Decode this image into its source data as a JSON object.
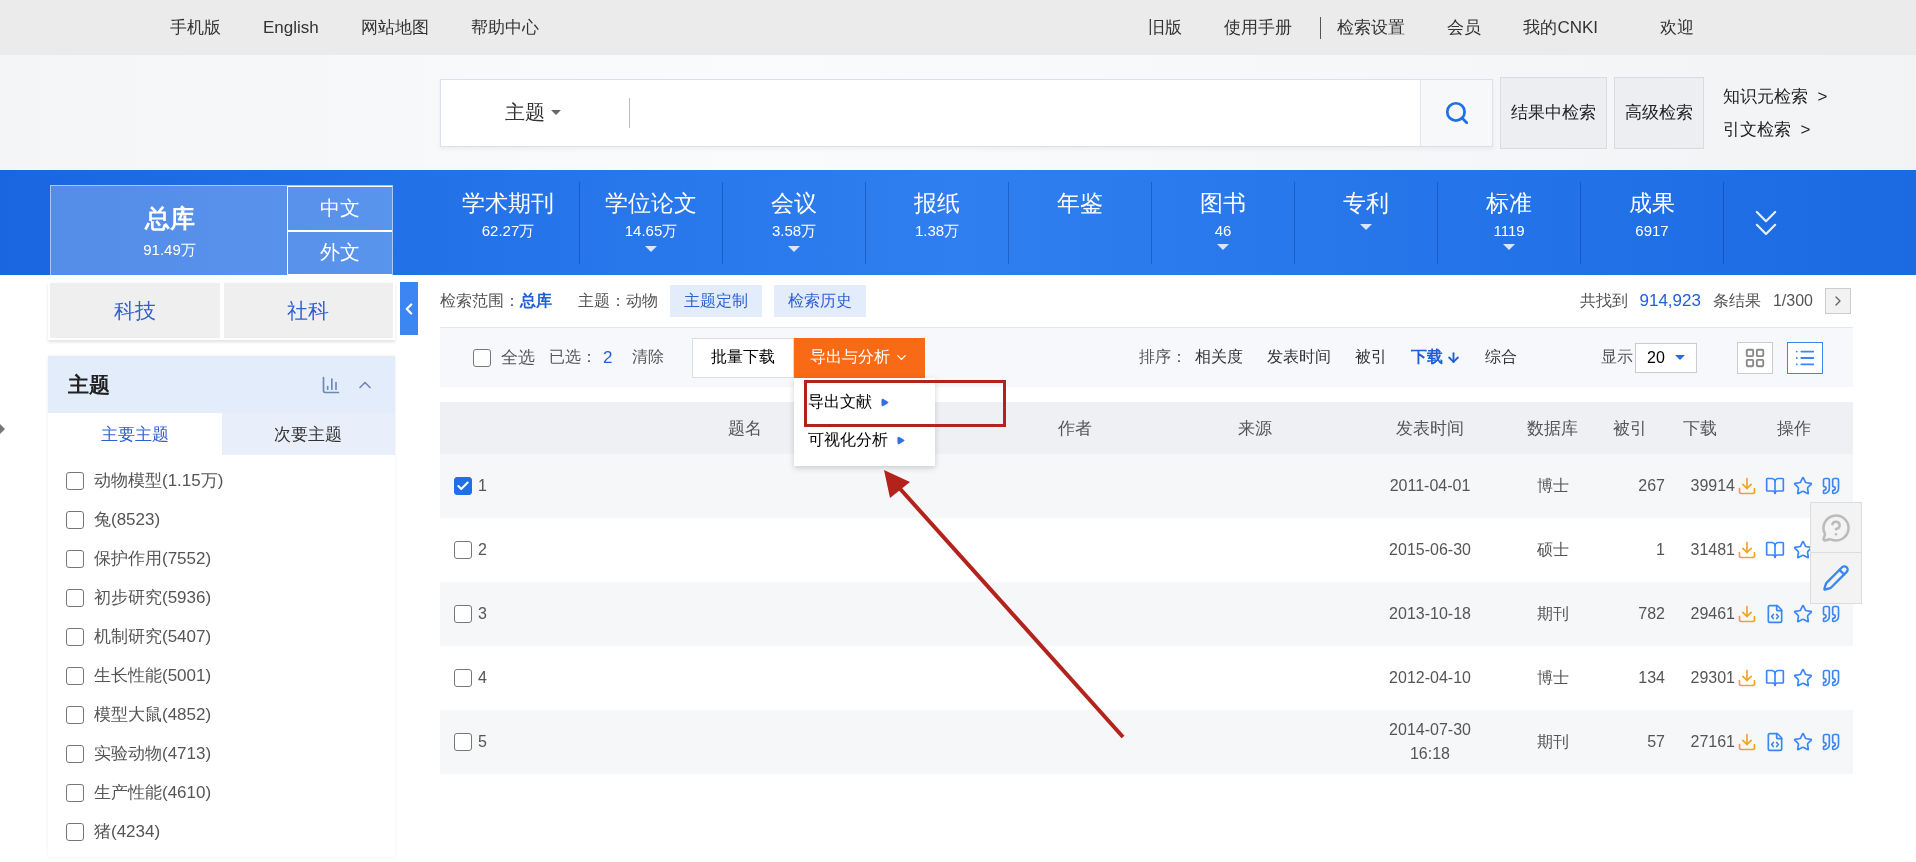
{
  "top_bar": {
    "left_links": [
      "手机版",
      "English",
      "网站地图",
      "帮助中心"
    ],
    "right_links": [
      "旧版",
      "使用手册",
      "检索设置",
      "会员",
      "我的CNKI",
      "欢迎"
    ]
  },
  "search": {
    "field_selector": "主题",
    "advanced_buttons": [
      "结果中检索",
      "高级检索"
    ],
    "side_links": [
      "知识元检索  >",
      "引文检索  >"
    ]
  },
  "database_nav": {
    "main": {
      "label": "总库",
      "count": "91.49万",
      "selected": true
    },
    "language_tabs": [
      {
        "label": "中文",
        "selected": false
      },
      {
        "label": "外文",
        "selected": false
      }
    ],
    "items": [
      {
        "label": "学术期刊",
        "count": "62.27万",
        "expandable": false
      },
      {
        "label": "学位论文",
        "count": "14.65万",
        "expandable": true
      },
      {
        "label": "会议",
        "count": "3.58万",
        "expandable": true
      },
      {
        "label": "报纸",
        "count": "1.38万",
        "expandable": false
      },
      {
        "label": "年鉴",
        "expandable": false
      },
      {
        "label": "图书",
        "count": "46",
        "expandable": true
      },
      {
        "label": "专利",
        "expandable": true
      },
      {
        "label": "标准",
        "count": "1119",
        "expandable": true
      },
      {
        "label": "成果",
        "count": "6917",
        "expandable": false
      }
    ]
  },
  "sidebar": {
    "categories": [
      "科技",
      "社科"
    ],
    "facet": {
      "title": "主题",
      "tabs": [
        {
          "label": "主要主题",
          "selected": true
        },
        {
          "label": "次要主题",
          "selected": false
        }
      ],
      "items": [
        {
          "label": "动物模型(1.15万)",
          "checked": false
        },
        {
          "label": "兔(8523)",
          "checked": false
        },
        {
          "label": "保护作用(7552)",
          "checked": false
        },
        {
          "label": "初步研究(5936)",
          "checked": false
        },
        {
          "label": "机制研究(5407)",
          "checked": false
        },
        {
          "label": "生长性能(5001)",
          "checked": false
        },
        {
          "label": "模型大鼠(4852)",
          "checked": false
        },
        {
          "label": "实验动物(4713)",
          "checked": false
        },
        {
          "label": "生产性能(4610)",
          "checked": false
        },
        {
          "label": "猪(4234)",
          "checked": false
        }
      ]
    }
  },
  "scope": {
    "label": "检索范围：",
    "value": "总库",
    "query": "主题：动物",
    "buttons": [
      "主题定制",
      "检索历史"
    ],
    "found_prefix": "共找到",
    "found_count": "914,923",
    "found_suffix": "条结果",
    "page": "1/300"
  },
  "toolbar": {
    "select_all": {
      "label": "全选",
      "checked": false
    },
    "selected_label": "已选：",
    "selected_count": "2",
    "clear": "清除",
    "batch_download": "批量下载",
    "export_menu": "导出与分析",
    "menu_items": [
      "导出文献",
      "可视化分析"
    ],
    "sort_label": "排序：",
    "sort_options": [
      {
        "label": "相关度",
        "selected": false
      },
      {
        "label": "发表时间",
        "selected": false
      },
      {
        "label": "被引",
        "selected": false
      },
      {
        "label": "下载",
        "selected": true
      },
      {
        "label": "综合",
        "selected": false
      }
    ],
    "display_label": "显示",
    "page_size": "20"
  },
  "table": {
    "columns": [
      "题名",
      "作者",
      "来源",
      "发表时间",
      "数据库",
      "被引",
      "下载",
      "操作"
    ],
    "rows": [
      {
        "number": "1",
        "checked": true,
        "date": "2011-04-01",
        "database": "博士",
        "cited": "267",
        "downloads": "39914",
        "actions": [
          {
            "kind": "download"
          },
          {
            "kind": "book"
          },
          {
            "kind": "star"
          },
          {
            "kind": "quote"
          }
        ]
      },
      {
        "number": "2",
        "checked": false,
        "date": "2015-06-30",
        "database": "硕士",
        "cited": "1",
        "downloads": "31481",
        "actions": [
          {
            "kind": "download"
          },
          {
            "kind": "book"
          },
          {
            "kind": "star"
          }
        ]
      },
      {
        "number": "3",
        "checked": false,
        "date": "2013-10-18",
        "database": "期刊",
        "cited": "782",
        "downloads": "29461",
        "actions": [
          {
            "kind": "download"
          },
          {
            "kind": "html"
          },
          {
            "kind": "star"
          },
          {
            "kind": "quote"
          }
        ]
      },
      {
        "number": "4",
        "checked": false,
        "date": "2012-04-10",
        "database": "博士",
        "cited": "134",
        "downloads": "29301",
        "actions": [
          {
            "kind": "download"
          },
          {
            "kind": "book"
          },
          {
            "kind": "star"
          },
          {
            "kind": "quote"
          }
        ]
      },
      {
        "number": "5",
        "checked": false,
        "date": "2014-07-30\n16:18",
        "database": "期刊",
        "cited": "57",
        "downloads": "27161",
        "actions": [
          {
            "kind": "download"
          },
          {
            "kind": "html"
          },
          {
            "kind": "star"
          },
          {
            "kind": "quote"
          }
        ]
      }
    ]
  }
}
